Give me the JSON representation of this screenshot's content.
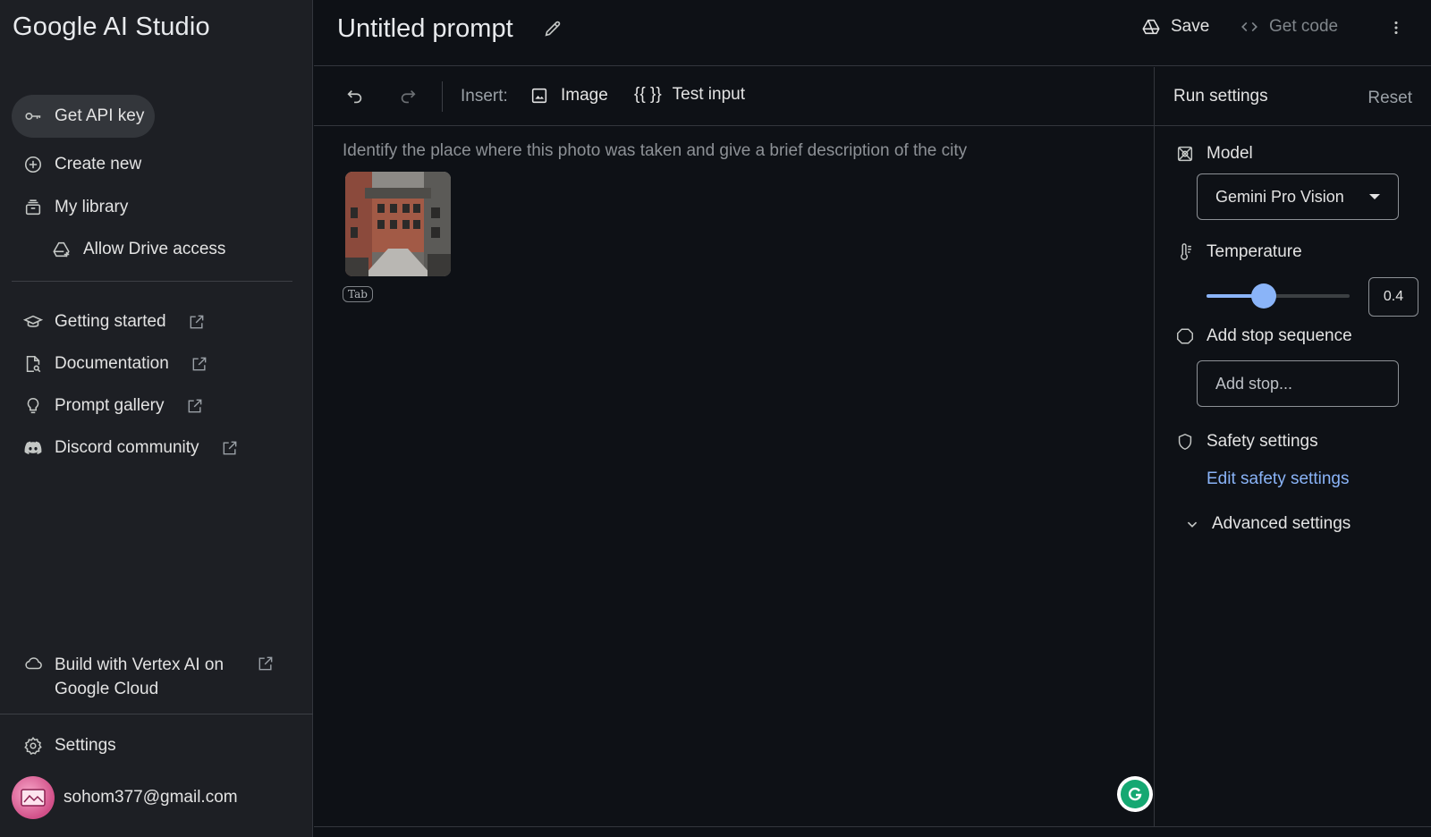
{
  "sidebar": {
    "brand": "Google AI Studio",
    "primary": [
      {
        "label": "Get API key",
        "icon": "key-icon"
      },
      {
        "label": "Create new",
        "icon": "add-circle-icon"
      },
      {
        "label": "My library",
        "icon": "library-icon"
      },
      {
        "label": "Allow Drive access",
        "icon": "drive-add-icon"
      }
    ],
    "resources": [
      {
        "label": "Getting started",
        "icon": "school-icon"
      },
      {
        "label": "Documentation",
        "icon": "document-search-icon"
      },
      {
        "label": "Prompt gallery",
        "icon": "lightbulb-icon"
      },
      {
        "label": "Discord community",
        "icon": "discord-icon"
      }
    ],
    "vertex_label": "Build with Vertex AI on Google Cloud",
    "settings_label": "Settings",
    "account_email": "sohom377@gmail.com"
  },
  "header": {
    "title": "Untitled prompt",
    "save_label": "Save",
    "get_code_label": "Get code"
  },
  "toolbar": {
    "insert_label": "Insert:",
    "image_label": "Image",
    "test_input_braces": "{{ }}",
    "test_input_label": "Test input"
  },
  "editor": {
    "prompt_text": "Identify the place where this photo was taken and give a brief description of the city",
    "tab_hint": "Tab"
  },
  "run_settings": {
    "title": "Run settings",
    "reset_label": "Reset",
    "model_label": "Model",
    "model_value": "Gemini Pro Vision",
    "temperature_label": "Temperature",
    "temperature_value": "0.4",
    "temperature_fraction": 0.4,
    "stop_label": "Add stop sequence",
    "stop_placeholder": "Add stop...",
    "safety_label": "Safety settings",
    "edit_safety_label": "Edit safety settings",
    "advanced_label": "Advanced settings"
  },
  "colors": {
    "background": "#0e1116",
    "sidebar": "#1d1f24",
    "accent": "#8ab4f8",
    "grammarly": "#15a872"
  }
}
